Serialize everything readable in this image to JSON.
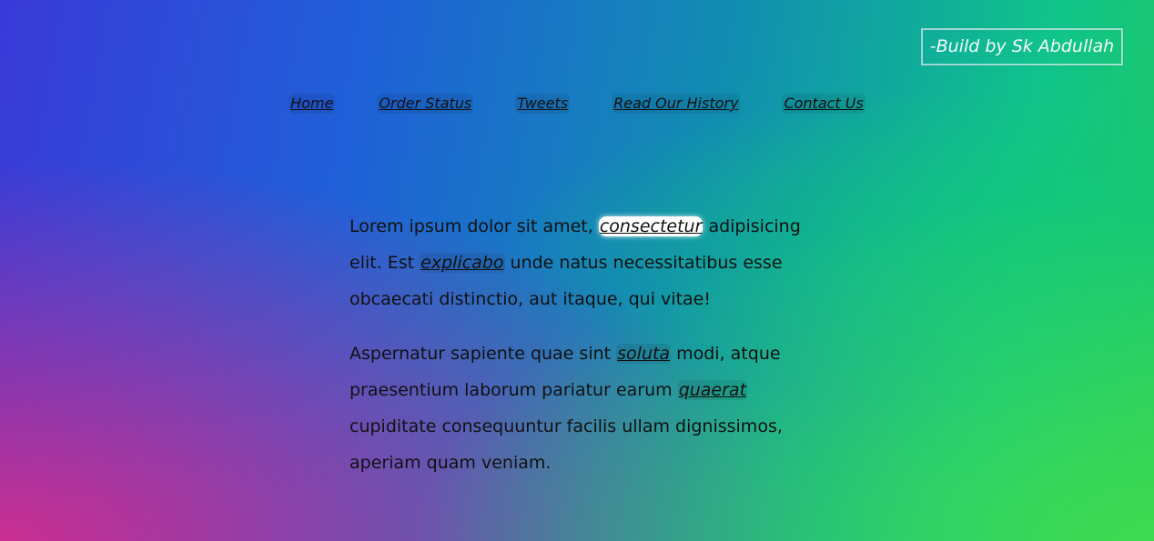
{
  "badge": {
    "label": "-Build by Sk Abdullah"
  },
  "nav": {
    "items": [
      {
        "label": "Home"
      },
      {
        "label": "Order Status"
      },
      {
        "label": "Tweets"
      },
      {
        "label": "Read Our History"
      },
      {
        "label": "Contact Us"
      }
    ]
  },
  "content": {
    "p1": {
      "t1": "Lorem ipsum dolor sit amet, ",
      "link1": "consectetur",
      "t2": " adipisicing elit. Est ",
      "link2": "explicabo",
      "t3": " unde natus necessitatibus esse obcaecati distinctio, aut itaque, qui vitae!"
    },
    "p2": {
      "t1": "Aspernatur sapiente quae sint ",
      "link1": "soluta",
      "t2": " modi, atque praesentium laborum pariatur earum ",
      "link2": "quaerat",
      "t3": " cupiditate consequuntur facilis ullam dignissimos, aperiam quam veniam."
    }
  }
}
